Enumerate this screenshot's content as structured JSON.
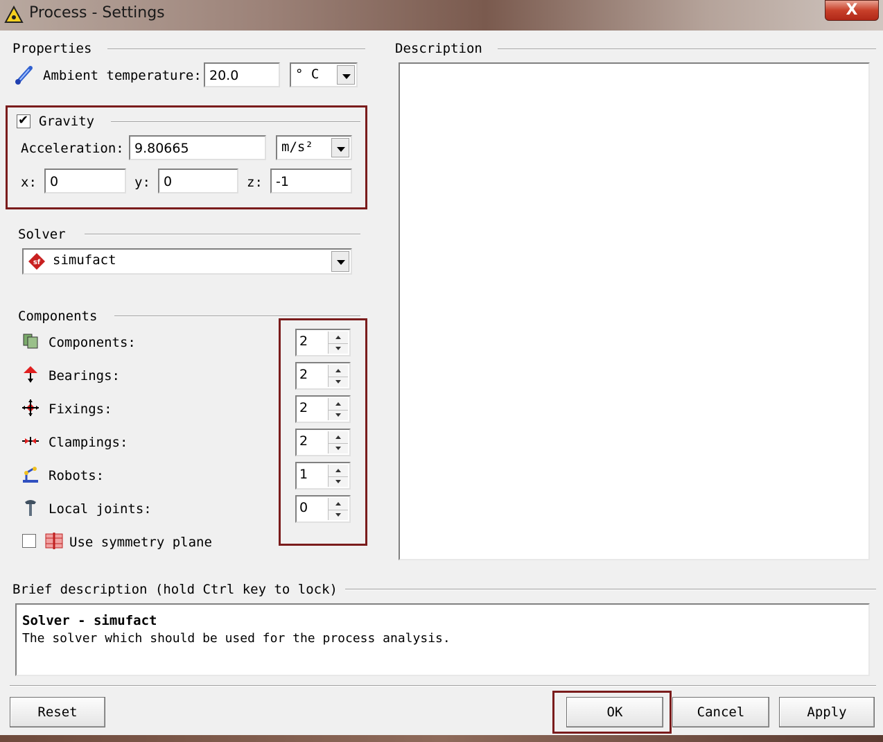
{
  "window": {
    "title": "Process - Settings",
    "close_label": "X"
  },
  "properties": {
    "group_label": "Properties",
    "ambient_label": "Ambient temperature:",
    "ambient_value": "20.0",
    "ambient_unit": "° C"
  },
  "gravity": {
    "checkbox_label": "Gravity",
    "checked": "✔",
    "accel_label": "Acceleration:",
    "accel_value": "9.80665",
    "accel_unit": "m/s²",
    "x_label": "x:",
    "x_value": "0",
    "y_label": "y:",
    "y_value": "0",
    "z_label": "z:",
    "z_value": "-1"
  },
  "solver": {
    "group_label": "Solver",
    "value": "simufact"
  },
  "components": {
    "group_label": "Components",
    "items": [
      {
        "label": "Components:",
        "value": "2",
        "icon": "components-icon"
      },
      {
        "label": "Bearings:",
        "value": "2",
        "icon": "bearings-icon"
      },
      {
        "label": "Fixings:",
        "value": "2",
        "icon": "fixings-icon"
      },
      {
        "label": "Clampings:",
        "value": "2",
        "icon": "clampings-icon"
      },
      {
        "label": "Robots:",
        "value": "1",
        "icon": "robots-icon"
      },
      {
        "label": "Local joints:",
        "value": "0",
        "icon": "local-joints-icon"
      }
    ],
    "symmetry_label": "Use symmetry plane"
  },
  "description": {
    "group_label": "Description"
  },
  "brief": {
    "group_label": "Brief description (hold Ctrl key to lock)",
    "heading": "Solver - simufact",
    "text": "The solver which should be used for the process analysis."
  },
  "buttons": {
    "reset": "Reset",
    "ok": "OK",
    "cancel": "Cancel",
    "apply": "Apply"
  },
  "colors": {
    "highlight_box": "#7a1c1c",
    "dialog_bg": "#f0f0f0"
  }
}
